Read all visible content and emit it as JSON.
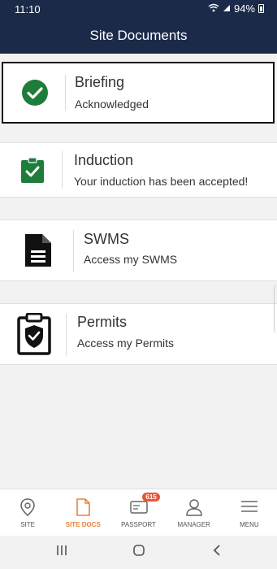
{
  "status": {
    "time": "11:10",
    "battery": "94%"
  },
  "header": {
    "title": "Site Documents"
  },
  "cards": [
    {
      "title": "Briefing",
      "subtitle": "Acknowledged"
    },
    {
      "title": "Induction",
      "subtitle": "Your induction has been accepted!"
    },
    {
      "title": "SWMS",
      "subtitle": "Access my SWMS"
    },
    {
      "title": "Permits",
      "subtitle": "Access my Permits"
    }
  ],
  "tabs": [
    {
      "label": "SITE"
    },
    {
      "label": "SITE DOCS"
    },
    {
      "label": "PASSPORT",
      "badge": "615"
    },
    {
      "label": "MANAGER"
    },
    {
      "label": "MENU"
    }
  ],
  "colors": {
    "header_bg": "#1c2a4a",
    "success": "#1e7d3a",
    "accent": "#e8833a",
    "badge": "#e8573a"
  }
}
